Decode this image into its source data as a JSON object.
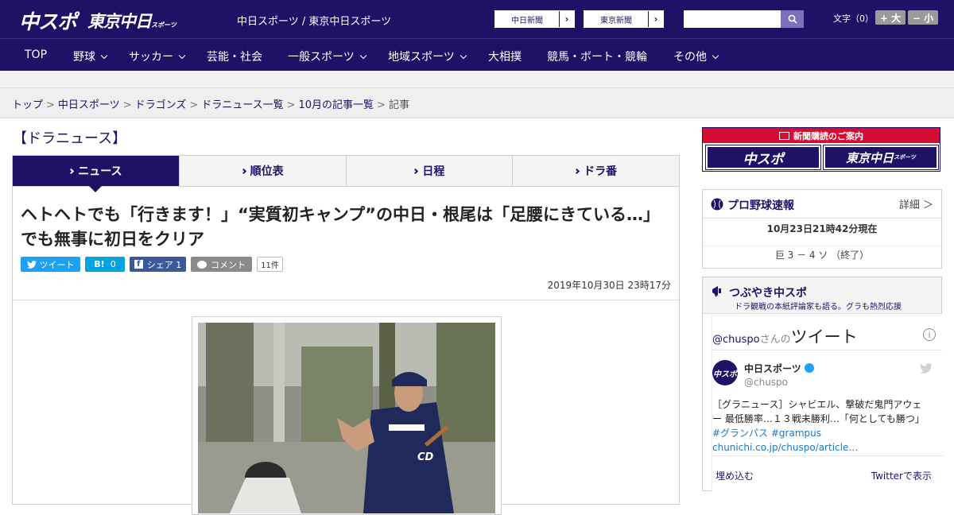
{
  "header": {
    "logo_chuspo": "中スポ",
    "logo_tokyo": "東京中日",
    "logo_tokyo_sub": "スポーツ",
    "site_name": "中日スポーツ / 東京中日スポーツ",
    "ext_links": [
      {
        "label": "中日新聞",
        "arrow": "›"
      },
      {
        "label": "東京新聞",
        "arrow": "›"
      }
    ],
    "search_placeholder": "",
    "font_size_label": "文字（0）",
    "font_bigger": "+ 大",
    "font_smaller": "− 小"
  },
  "nav": {
    "items": [
      {
        "label": "TOP",
        "dropdown": false
      },
      {
        "label": "野球",
        "dropdown": true
      },
      {
        "label": "サッカー",
        "dropdown": true
      },
      {
        "label": "芸能・社会",
        "dropdown": false
      },
      {
        "label": "一般スポーツ",
        "dropdown": true
      },
      {
        "label": "地域スポーツ",
        "dropdown": true
      },
      {
        "label": "大相撲",
        "dropdown": false
      },
      {
        "label": "競馬・ボート・競輪",
        "dropdown": false
      },
      {
        "label": "その他",
        "dropdown": true
      }
    ]
  },
  "breadcrumb": {
    "items": [
      "トップ",
      "中日スポーツ",
      "ドラゴンズ",
      "ドラニュース一覧",
      "10月の記事一覧"
    ],
    "separator": ">",
    "current": "記事"
  },
  "section_title": "【ドラニュース】",
  "tabs": [
    {
      "label": "ニュース",
      "active": true
    },
    {
      "label": "順位表",
      "active": false
    },
    {
      "label": "日程",
      "active": false
    },
    {
      "label": "ドラ番",
      "active": false
    }
  ],
  "article": {
    "headline": "ヘトヘトでも「行きます！」“実質初キャンプ”の中日・根尾は「足腰にきている…」でも無事に初日をクリア",
    "share": {
      "tweet": "ツイート",
      "hatena_icon": "B!",
      "hatena_count": "0",
      "facebook": "シェア 1",
      "comment": "コメント",
      "comment_count": "11件"
    },
    "date": "2019年10月30日 23時17分",
    "photo_uniform_text": "CD"
  },
  "sidebar": {
    "subscribe": {
      "header": "新聞購読のご案内",
      "logo1": "中スポ",
      "logo2": "東京中日",
      "logo2_sub": "スポーツ"
    },
    "baseball": {
      "title": "プロ野球速報",
      "more": "詳細 ＞",
      "time": "10月23日21時42分現在",
      "score": "巨 3 － 4 ソ （終了）"
    },
    "twitter": {
      "title": "つぶやき中スポ",
      "subtitle": "ドラ観戦の本紙評論家も語る。グラも熱烈応援",
      "handle_prefix": "@chuspo",
      "handle_suffix": "さんの",
      "tweets_word": "ツイート",
      "info_icon": "i",
      "user_name": "中日スポーツ",
      "user_handle": "@chuspo",
      "avatar_text": "中スポ",
      "tweet_text": "［グラニュース］シャビエル、撃破だ鬼門アウェー 最低勝率…１３戦未勝利…「何としても勝つ」",
      "tweet_tags": "#グランパス #grampus",
      "tweet_link": "chunichi.co.jp/chuspo/article…",
      "embed": "埋め込む",
      "view_on": "Twitterで表示"
    }
  },
  "colors": {
    "brand": "#1f1266",
    "twitter": "#1da1f2",
    "hatena": "#00a4de",
    "facebook": "#3b5998",
    "subscribe_red": "#d60d33"
  }
}
